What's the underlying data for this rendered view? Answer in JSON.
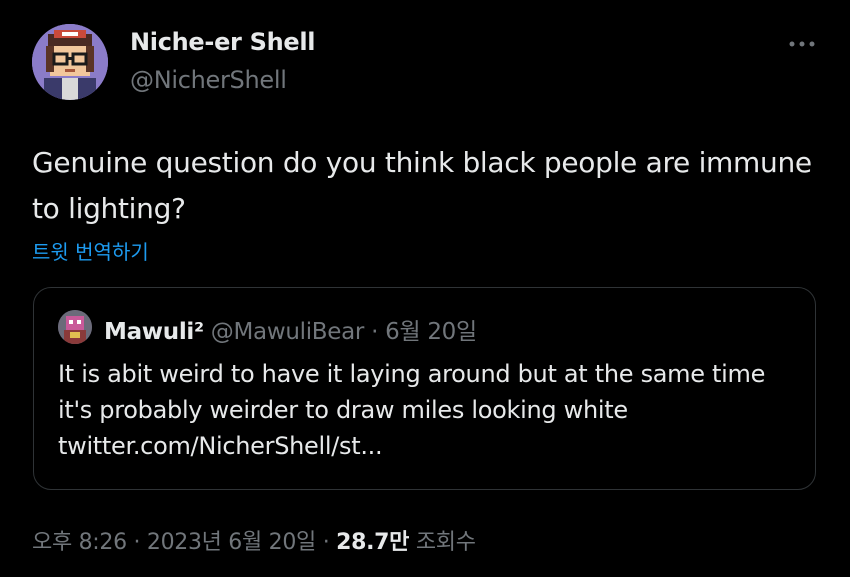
{
  "author": {
    "display_name": "Niche-er Shell",
    "handle": "@NicherShell"
  },
  "tweet": {
    "text": "Genuine question do you think black people are immune to lighting?",
    "translate_label": "트윗 번역하기"
  },
  "quoted_tweet": {
    "display_name": "Mawuli²",
    "handle": "@MawuliBear",
    "separator": "·",
    "date": "6월 20일",
    "text": "It is abit weird to have it laying around but at the same time it's probably weirder to draw miles looking white twitter.com/NicherShell/st..."
  },
  "meta": {
    "time": "오후 8:26",
    "separator1": "·",
    "date": "2023년 6월 20일",
    "separator2": "·",
    "views_count": "28.7만",
    "views_label": "조회수"
  },
  "icons": {
    "more": "more-icon"
  },
  "colors": {
    "background": "#000000",
    "text": "#e7e9ea",
    "secondary": "#71767b",
    "link": "#1d9bf0",
    "border": "#2f3336"
  }
}
